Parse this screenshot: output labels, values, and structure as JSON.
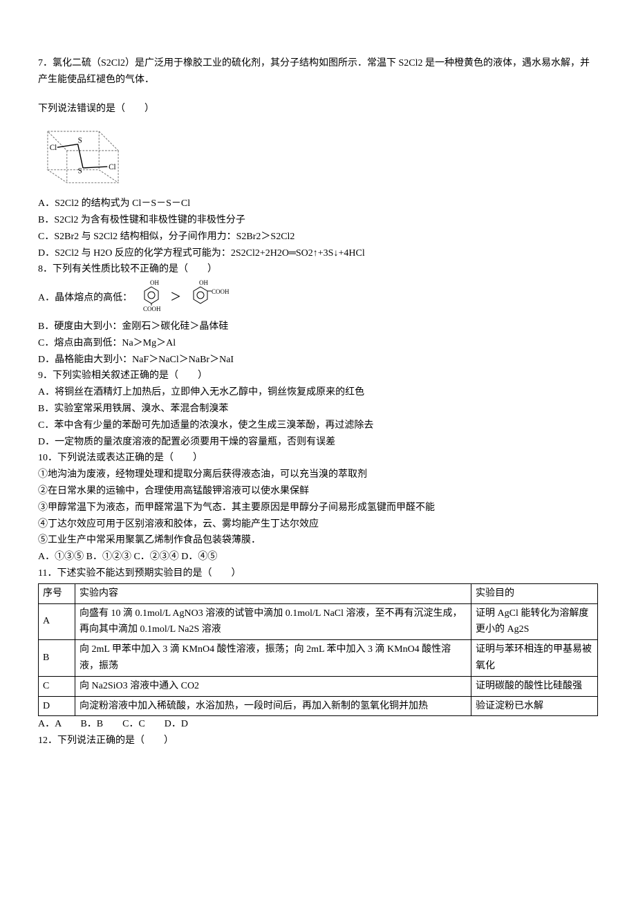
{
  "q7": {
    "stem1": "7．氯化二硫（S2Cl2）是广泛用于橡胶工业的硫化剂，其分子结构如图所示．常温下 S2Cl2 是一种橙黄色的液体，遇水易水解，并产生能使品红褪色的气体．",
    "stem2": "下列说法错误的是（　　）",
    "diagram_label": "S2Cl2 3D structure (Cl–S–S–Cl)",
    "A": "A．S2Cl2 的结构式为 Cl－S－S－Cl",
    "B": "B．S2Cl2 为含有极性键和非极性键的非极性分子",
    "C": "C．S2Br2 与 S2Cl2 结构相似，分子间作用力：S2Br2＞S2Cl2",
    "D": "D．S2Cl2 与 H2O 反应的化学方程式可能为：2S2Cl2+2H2O═SO2↑+3S↓+4HCl"
  },
  "q8": {
    "stem": "8．下列有关性质比较不正确的是（　　）",
    "A_prefix": "A．晶体熔点的高低：",
    "A_struct_left": "对羟基苯甲酸",
    "A_struct_right": "邻羟基苯甲酸",
    "B": "B．硬度由大到小：金刚石＞碳化硅＞晶体硅",
    "C": "C．熔点由高到低：Na＞Mg＞Al",
    "D": "D．晶格能由大到小：NaF＞NaCl＞NaBr＞NaI"
  },
  "q9": {
    "stem": "9．下列实验相关叙述正确的是（　　）",
    "A": "A．将铜丝在酒精灯上加热后，立即伸入无水乙醇中，铜丝恢复成原来的红色",
    "B": "B．实验室常采用铁屑、溴水、苯混合制溴苯",
    "C": "C．苯中含有少量的苯酚可先加适量的浓溴水，使之生成三溴苯酚，再过滤除去",
    "D": "D．一定物质的量浓度溶液的配置必须要用干燥的容量瓶，否则有误差"
  },
  "q10": {
    "stem": "10．下列说法或表达正确的是（　　）",
    "s1": "①地沟油为废液，经物理处理和提取分离后获得液态油，可以充当溴的萃取剂",
    "s2": "②在日常水果的运输中，合理使用高锰酸钾溶液可以使水果保鲜",
    "s3": "③甲醇常温下为液态，而甲醛常温下为气态．其主要原因是甲醇分子间易形成氢键而甲醛不能",
    "s4": "④丁达尔效应可用于区别溶液和胶体，云、雾均能产生丁达尔效应",
    "s5": "⑤工业生产中常采用聚氯乙烯制作食品包装袋薄膜．",
    "opts": "A．①③⑤ B．①②③ C．②③④ D．④⑤"
  },
  "q11": {
    "stem": "11．下述实验不能达到预期实验目的是（　　）",
    "head_seq": "序号",
    "head_content": "实验内容",
    "head_purpose": "实验目的",
    "rows": [
      {
        "seq": "A",
        "content": "向盛有 10 滴 0.1mol/L AgNO3 溶液的试管中滴加 0.1mol/L NaCl 溶液，至不再有沉淀生成，再向其中滴加 0.1mol/L Na2S 溶液",
        "purpose": "证明 AgCl 能转化为溶解度更小的 Ag2S"
      },
      {
        "seq": "B",
        "content": "向 2mL 甲苯中加入 3 滴 KMnO4 酸性溶液，振荡；向 2mL 苯中加入 3 滴 KMnO4 酸性溶液，振荡",
        "purpose": "证明与苯环相连的甲基易被氧化"
      },
      {
        "seq": "C",
        "content": "向 Na2SiO3 溶液中通入 CO2",
        "purpose": "证明碳酸的酸性比硅酸强"
      },
      {
        "seq": "D",
        "content": "向淀粉溶液中加入稀硫酸，水浴加热，一段时间后，再加入新制的氢氧化铜并加热",
        "purpose": "验证淀粉已水解"
      }
    ],
    "opts": "A．A　　B．B　　C．C　　D．D"
  },
  "q12": {
    "stem": "12．下列说法正确的是（　　）"
  }
}
